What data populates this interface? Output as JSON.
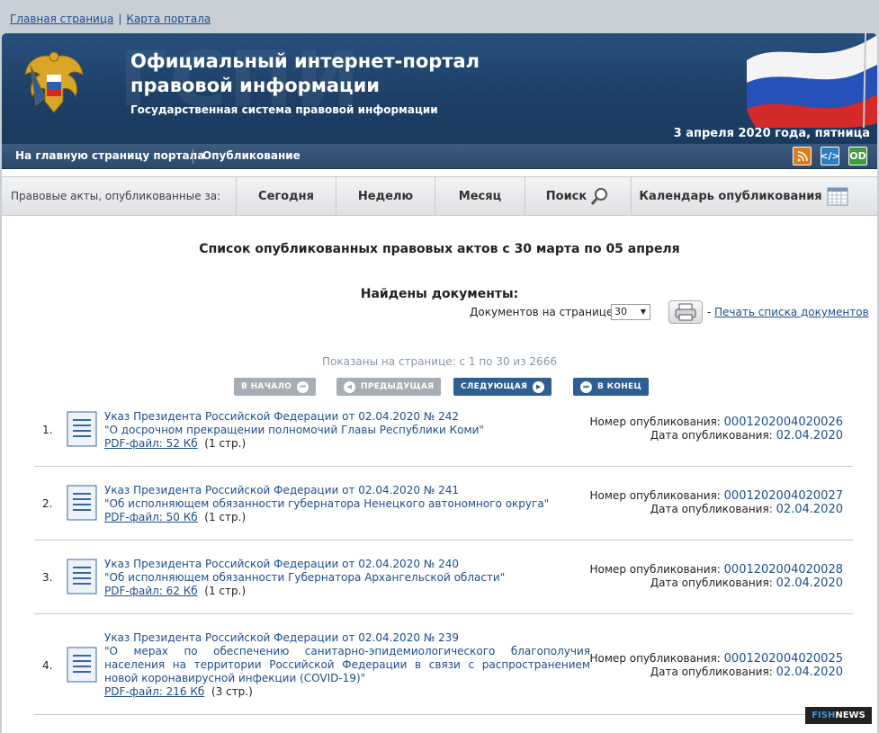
{
  "top_links": {
    "home": "Главная страница",
    "separator": "|",
    "map": "Карта портала"
  },
  "header": {
    "watermark": "ГСПИ",
    "title": "Официальный интернет-портал правовой информации",
    "subtitle": "Государственная система правовой информации",
    "date": "3 апреля 2020 года, пятница"
  },
  "nav": {
    "home": "На главную страницу портала",
    "publication": "Опубликование",
    "icons": [
      "rss-icon",
      "code-icon",
      "open-data-icon"
    ]
  },
  "filter": {
    "label": "Правовые акты, опубликованные за:",
    "tabs": [
      "Сегодня",
      "Неделю",
      "Месяц",
      "Поиск",
      "Календарь опубликования"
    ]
  },
  "list_title": "Список опубликованных правовых актов с 30 марта по 05 апреля",
  "found_title": "Найдены документы:",
  "per_page": {
    "label": "Документов на странице:",
    "value": "30"
  },
  "print": {
    "dash": "-",
    "label": "Печать списка документов"
  },
  "shown": "Показаны на странице: с 1 по 30 из 2666",
  "pager": {
    "first": "В НАЧАЛО",
    "prev": "ПРЕДЫДУЩАЯ",
    "next": "СЛЕДУЮЩАЯ",
    "last": "В КОНЕЦ"
  },
  "meta_labels": {
    "number": "Номер опубликования:",
    "date": "Дата опубликования:"
  },
  "documents": [
    {
      "num": "1.",
      "title": "Указ Президента Российской Федерации от 02.04.2020 № 242",
      "desc": "\"О досрочном прекращении полномочий Главы Республики Коми\"",
      "pdf": "PDF-файл: 52 Кб",
      "pages": "(1 стр.)",
      "pub_num": "0001202004020026",
      "pub_date": "02.04.2020"
    },
    {
      "num": "2.",
      "title": "Указ Президента Российской Федерации от 02.04.2020 № 241",
      "desc": "\"Об исполняющем обязанности губернатора Ненецкого автономного округа\"",
      "pdf": "PDF-файл: 50 Кб",
      "pages": "(1 стр.)",
      "pub_num": "0001202004020027",
      "pub_date": "02.04.2020"
    },
    {
      "num": "3.",
      "title": "Указ Президента Российской Федерации от 02.04.2020 № 240",
      "desc": "\"Об исполняющем обязанности Губернатора Архангельской области\"",
      "pdf": "PDF-файл: 62 Кб",
      "pages": "(1 стр.)",
      "pub_num": "0001202004020028",
      "pub_date": "02.04.2020"
    },
    {
      "num": "4.",
      "title": "Указ Президента Российской Федерации от 02.04.2020 № 239",
      "desc": "\"О мерах по обеспечению санитарно-эпидемиологического благополучия населения на территории Российской Федерации в связи с распространением новой коронавирусной инфекции (COVID-19)\"",
      "pdf": "PDF-файл: 216 Кб",
      "pages": "(3 стр.)",
      "pub_num": "0001202004020025",
      "pub_date": "02.04.2020"
    }
  ],
  "badge": {
    "part1": "FISH",
    "part2": "NEWS"
  },
  "colors": {
    "header_bg": "#1d3f66",
    "link": "#1d4e89",
    "pager_blue": "#2e5f92",
    "pager_gray": "#a6adb5"
  }
}
